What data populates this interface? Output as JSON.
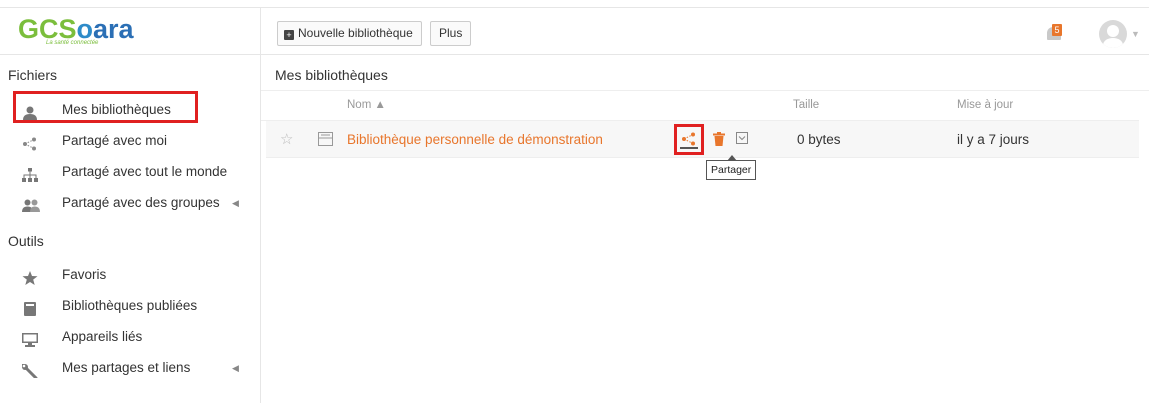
{
  "header": {
    "logo_text_parts": [
      "GC",
      "S",
      "o",
      "ara"
    ],
    "logo_tagline": "La santé connectée",
    "new_library_label": "Nouvelle bibliothèque",
    "more_label": "Plus",
    "notification_count": "5"
  },
  "sidebar": {
    "files_title": "Fichiers",
    "file_items": [
      {
        "label": "Mes bibliothèques",
        "icon": "user-icon",
        "selected": true
      },
      {
        "label": "Partagé avec moi",
        "icon": "share-icon"
      },
      {
        "label": "Partagé avec tout le monde",
        "icon": "org-chart-icon"
      },
      {
        "label": "Partagé avec des groupes",
        "icon": "group-icon",
        "has_arrow": true
      }
    ],
    "tools_title": "Outils",
    "tool_items": [
      {
        "label": "Favoris",
        "icon": "star-icon"
      },
      {
        "label": "Bibliothèques publiées",
        "icon": "book-icon"
      },
      {
        "label": "Appareils liés",
        "icon": "monitor-icon"
      },
      {
        "label": "Mes partages et liens",
        "icon": "wrench-icon",
        "has_arrow": true
      }
    ],
    "arrow_glyph": "◀"
  },
  "main": {
    "title": "Mes bibliothèques",
    "columns": {
      "name": "Nom ▲",
      "size": "Taille",
      "updated": "Mise à jour"
    },
    "rows": [
      {
        "name": "Bibliothèque personnelle de démonstration",
        "size": "0 bytes",
        "updated": "il y a 7 jours"
      }
    ],
    "tooltip": "Partager"
  },
  "colors": {
    "accent": "#e8762c",
    "highlight": "#e02020"
  }
}
